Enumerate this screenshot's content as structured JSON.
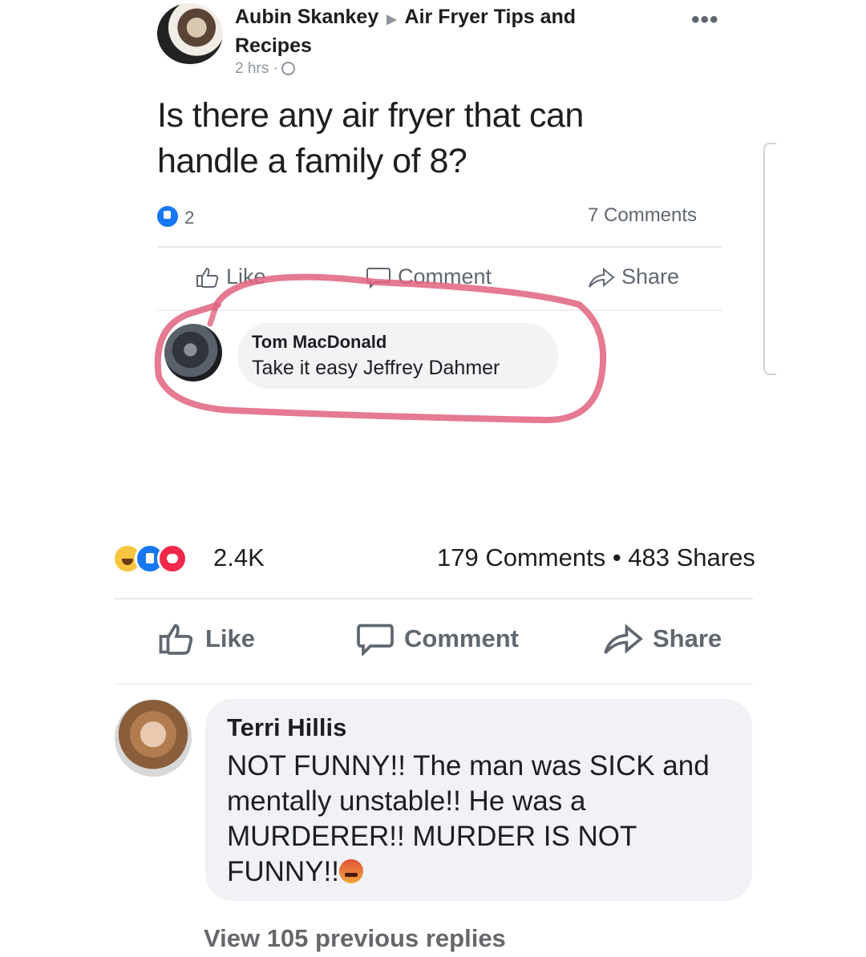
{
  "inner_post": {
    "author": "Aubin Skankey",
    "group": "Air Fryer Tips and Recipes",
    "time": "2 hrs ·",
    "more": "•••",
    "text": "Is there any air fryer that can handle a family of 8?",
    "reactions": "2",
    "comments_count": "7 Comments",
    "actions": {
      "like": "Like",
      "comment": "Comment",
      "share": "Share"
    },
    "comment": {
      "name": "Tom MacDonald",
      "text": "Take it easy Jeffrey Dahmer"
    }
  },
  "outer_post": {
    "reactions_count": "2.4K",
    "stats": "179 Comments • 483 Shares",
    "actions": {
      "like": "Like",
      "comment": "Comment",
      "share": "Share"
    },
    "comment": {
      "name": "Terri Hillis",
      "text": "NOT FUNNY!! The man was SICK and mentally unstable!! He was a MURDERER!! MURDER IS NOT FUNNY!!"
    },
    "view_replies": "View 105 previous replies"
  },
  "colors": {
    "highlight": "#e0637e",
    "link_blue": "#1877f2",
    "muted": "#606770"
  }
}
